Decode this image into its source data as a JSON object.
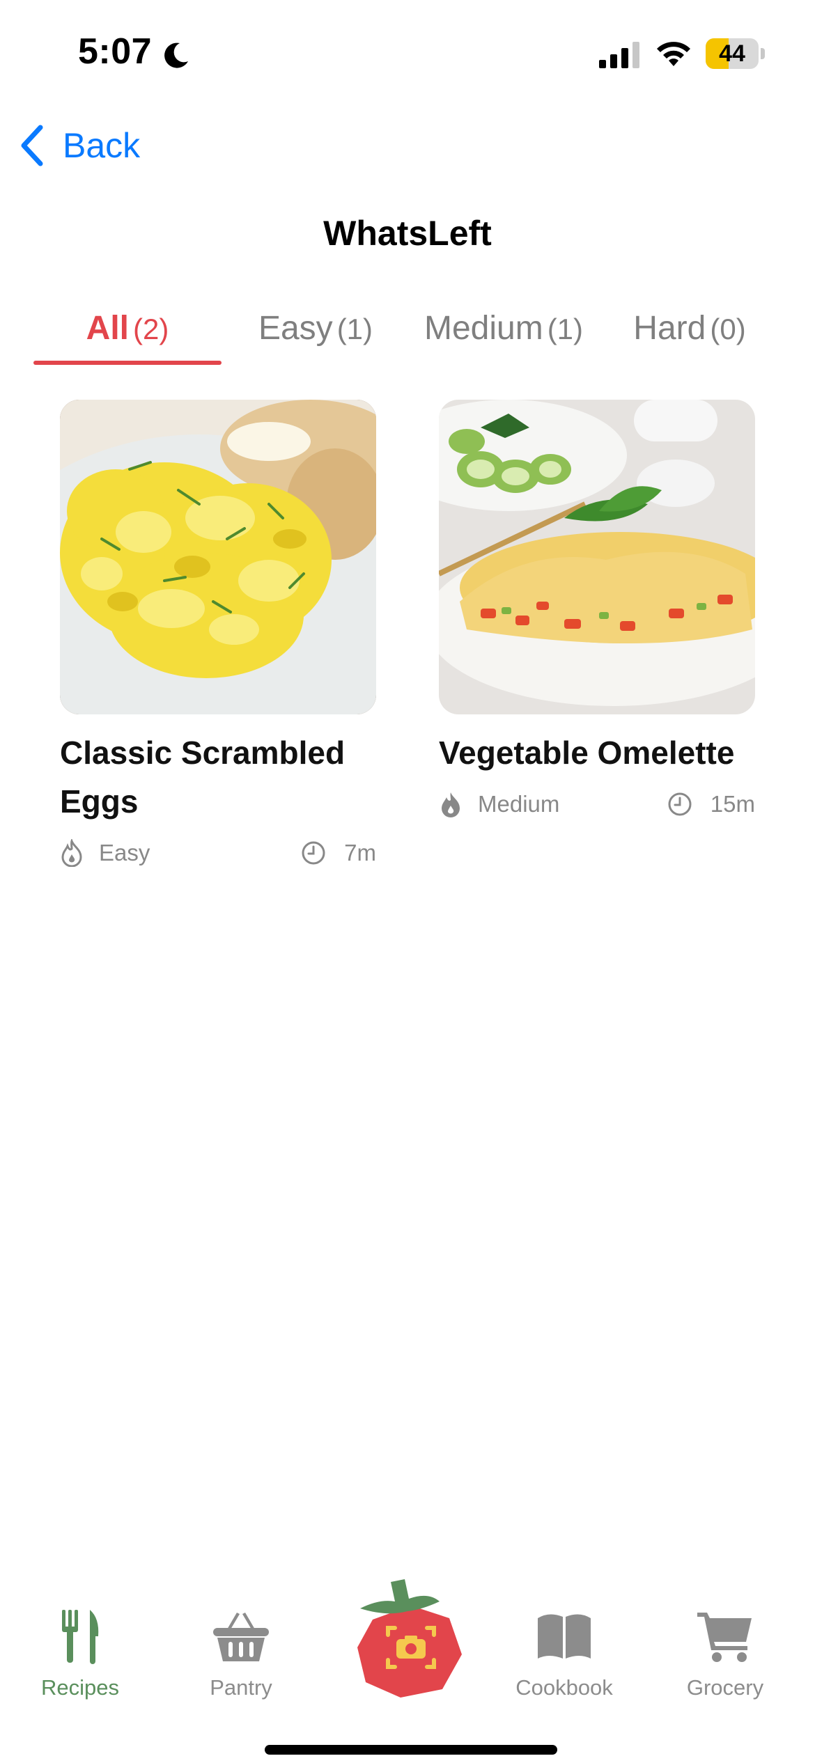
{
  "status_bar": {
    "time": "5:07",
    "battery_percent": 44,
    "battery_label": "44",
    "battery_color": "#f5c400"
  },
  "nav": {
    "back_label": "Back",
    "back_icon": "chevron-left-icon",
    "accent_color": "#0a7aff"
  },
  "page": {
    "title": "WhatsLeft"
  },
  "tabs": [
    {
      "label": "All",
      "count": "(2)",
      "active": true
    },
    {
      "label": "Easy",
      "count": "(1)",
      "active": false
    },
    {
      "label": "Medium",
      "count": "(1)",
      "active": false
    },
    {
      "label": "Hard",
      "count": "(0)",
      "active": false
    }
  ],
  "tab_accent": "#e2454b",
  "recipes": [
    {
      "title": "Classic Scrambled Eggs",
      "difficulty": "Easy",
      "time": "7m",
      "image": "scrambled-eggs-photo"
    },
    {
      "title": "Vegetable Omelette",
      "difficulty": "Medium",
      "time": "15m",
      "image": "vegetable-omelette-photo"
    }
  ],
  "tabbar": {
    "items": [
      {
        "label": "Recipes",
        "icon": "fork-knife-icon",
        "active": true
      },
      {
        "label": "Pantry",
        "icon": "basket-icon",
        "active": false
      },
      {
        "label": "Cookbook",
        "icon": "book-icon",
        "active": false
      },
      {
        "label": "Grocery",
        "icon": "cart-icon",
        "active": false
      }
    ],
    "center": {
      "icon": "tomato-camera-icon"
    },
    "active_color": "#5a8f5c"
  }
}
